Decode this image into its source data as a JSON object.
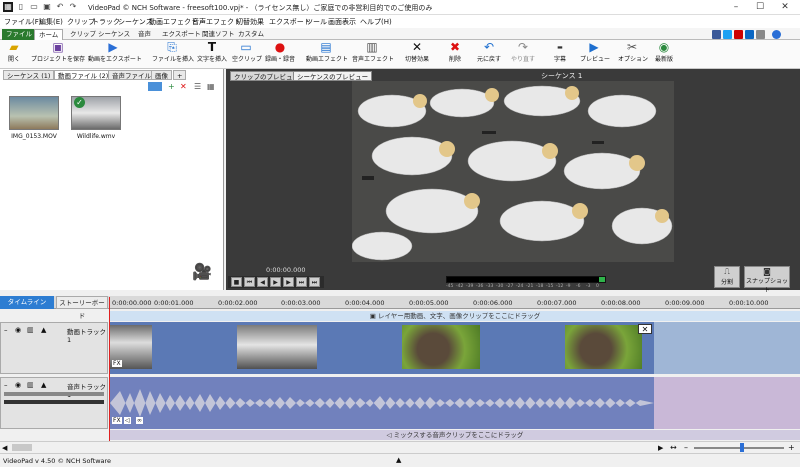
{
  "title": "VideoPad © NCH Software - freesoft100.vpj* - （ライセンス無し）ご家庭での非営利目的でのご使用のみ",
  "window_controls": {
    "minimize": "–",
    "maximize": "☐",
    "close": "✕"
  },
  "menu": [
    "ファイル(F)",
    "編集(E)",
    "クリップ",
    "トラック",
    "シーケンス",
    "動画エフェクト",
    "音声エフェクト",
    "切替効果",
    "エクスポート",
    "ツール",
    "画面表示",
    "ヘルプ(H)"
  ],
  "ribbon_tabs": [
    "ファイル",
    "ホーム",
    "クリップ",
    "シーケンス",
    "音声",
    "エクスポート",
    "関連ソフト",
    "カスタム"
  ],
  "ribbon_active": "ホーム",
  "ribbon_buttons": [
    {
      "label": "開く",
      "icon": "open-folder-icon"
    },
    {
      "label": "プロジェクトを保存",
      "icon": "save-icon"
    },
    {
      "label": "動画をエクスポート",
      "icon": "export-video-icon"
    },
    {
      "label": "ファイルを挿入",
      "icon": "insert-file-icon"
    },
    {
      "label": "文字を挿入",
      "icon": "insert-text-icon"
    },
    {
      "label": "空クリップ",
      "icon": "blank-clip-icon"
    },
    {
      "label": "録画・録音",
      "icon": "record-icon"
    },
    {
      "label": "動画エフェクト",
      "icon": "video-effects-icon"
    },
    {
      "label": "音声エフェクト",
      "icon": "audio-effects-icon"
    },
    {
      "label": "切替効果",
      "icon": "transition-icon"
    },
    {
      "label": "削除",
      "icon": "delete-icon"
    },
    {
      "label": "元に戻す",
      "icon": "undo-icon"
    },
    {
      "label": "やり直す",
      "icon": "redo-icon"
    },
    {
      "label": "字幕",
      "icon": "subtitle-icon"
    },
    {
      "label": "プレビュー",
      "icon": "preview-icon"
    },
    {
      "label": "オプション",
      "icon": "options-icon"
    },
    {
      "label": "最新版",
      "icon": "update-icon"
    }
  ],
  "bin_tabs": [
    "シーケンス",
    "動画ファイル",
    "音声ファイル",
    "画像",
    "+"
  ],
  "bin_tab_counts": [
    "(1)",
    "(2)"
  ],
  "media": [
    {
      "name": "IMG_0153.MOV"
    },
    {
      "name": "Wildlife.wmv"
    }
  ],
  "preview": {
    "tabs": [
      "クリップのプレビュー",
      "シーケンスのプレビュー"
    ],
    "sequence_title": "シーケンス 1",
    "timecode": "0:00:00.000",
    "split_label": "分割",
    "snapshot_label": "スナップショット",
    "meter_labels": [
      "-45",
      "-42",
      "-39",
      "-36",
      "-33",
      "-30",
      "-27",
      "-24",
      "-21",
      "-18",
      "-15",
      "-12",
      "-9",
      "-6",
      "-3",
      "0"
    ]
  },
  "timeline": {
    "tab_timeline": "タイムライン",
    "tab_storyboard": "ストーリーボード",
    "ruler": [
      "0:00:00.000",
      "0:00:01.000",
      "0:00:02.000",
      "0:00:03.000",
      "0:00:04.000",
      "0:00:05.000",
      "0:00:06.000",
      "0:00:07.000",
      "0:00:08.000",
      "0:00:09.000",
      "0:00:10.000"
    ],
    "overlay_hint": "レイヤー用動画、文字、画像クリップをここにドラッグ",
    "video_track_name": "動画トラック 1",
    "audio_track_name": "音声トラック 1",
    "audio_hint": "ミックスする音声クリップをここにドラッグ",
    "fx_label": "FX"
  },
  "status": {
    "version": "VideoPad v 4.50 © NCH Software"
  },
  "colors": {
    "file_tab": "#2a7a2e",
    "timeline_tab": "#2d7dd2",
    "video_track": "#5b79b5",
    "audio_track": "#7181bd",
    "playhead": "#e02020"
  }
}
